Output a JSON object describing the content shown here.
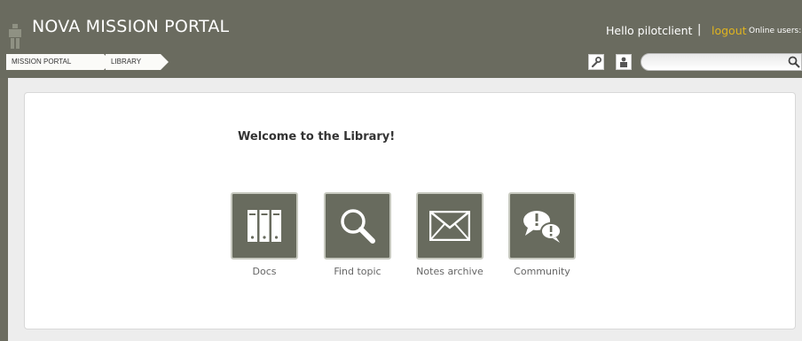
{
  "header": {
    "app_title": "NOVA MISSION PORTAL",
    "greeting": "Hello pilotclient",
    "separator": "|",
    "logout_label": "logout",
    "online_users_label": "Online users:",
    "colors": {
      "bar": "#6a6b5f",
      "logout": "#e0b41f"
    }
  },
  "breadcrumb": [
    {
      "label": "MISSION PORTAL"
    },
    {
      "label": "LIBRARY"
    }
  ],
  "tools": {
    "wrench_icon": "wrench-icon",
    "user_icon": "user-icon",
    "search_icon": "search-icon",
    "search_value": ""
  },
  "main": {
    "welcome": "Welcome to the Library!",
    "tiles": [
      {
        "label": "Docs",
        "icon": "binders-icon"
      },
      {
        "label": "Find topic",
        "icon": "magnifier-icon"
      },
      {
        "label": "Notes archive",
        "icon": "envelope-icon"
      },
      {
        "label": "Community",
        "icon": "chat-bubbles-icon"
      }
    ],
    "tile_color": "#686b5e"
  }
}
